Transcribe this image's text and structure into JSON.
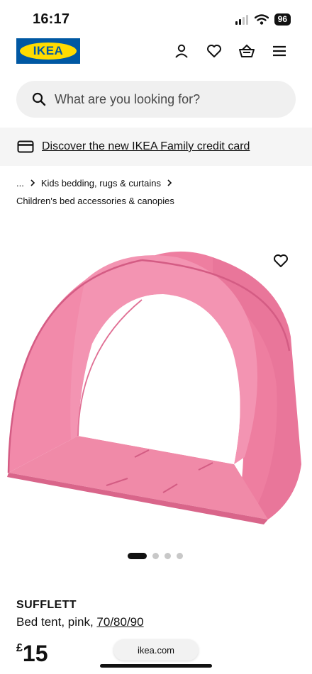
{
  "status_bar": {
    "time": "16:17",
    "battery": "96"
  },
  "header": {
    "logo_text": "IKEA"
  },
  "search": {
    "placeholder": "What are you looking for?"
  },
  "banner": {
    "link_text": "Discover the new IKEA Family credit card"
  },
  "breadcrumb": {
    "ellipsis": "...",
    "parent": "Kids bedding, rugs & curtains",
    "current": "Children's bed accessories & canopies"
  },
  "carousel": {
    "total": 4,
    "active_index": 0
  },
  "product": {
    "name": "SUFFLETT",
    "description": "Bed tent, pink,",
    "size": "70/80/90",
    "currency": "£",
    "price": "15"
  },
  "browser": {
    "url": "ikea.com"
  },
  "colors": {
    "ikea_blue": "#0058a3",
    "ikea_yellow": "#ffdb00",
    "tent_pink": "#f07a9a"
  }
}
